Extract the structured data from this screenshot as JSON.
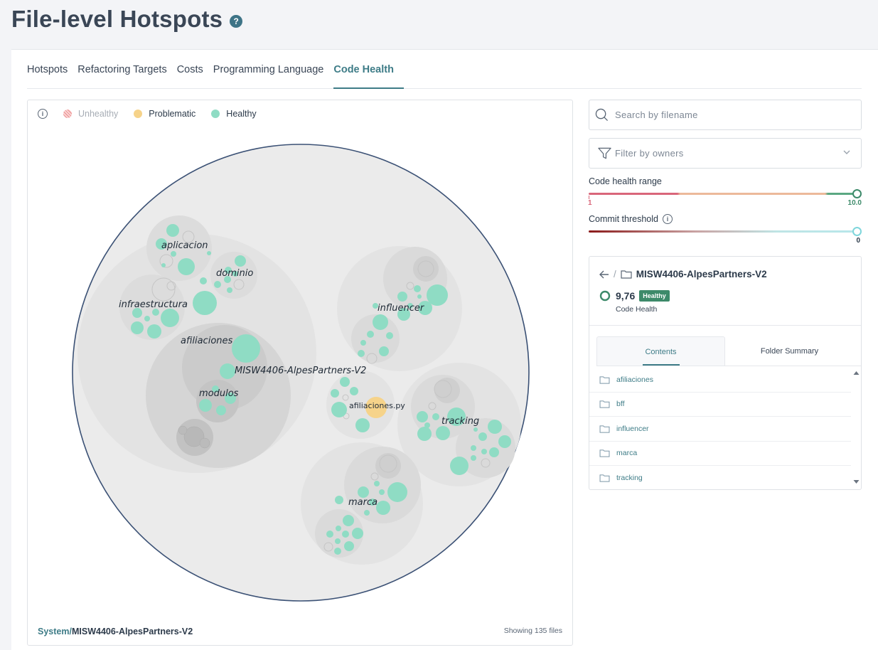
{
  "page": {
    "title": "File-level Hotspots",
    "help_glyph": "?"
  },
  "tabs": [
    {
      "label": "Hotspots",
      "active": false
    },
    {
      "label": "Refactoring Targets",
      "active": false
    },
    {
      "label": "Costs",
      "active": false
    },
    {
      "label": "Programming Language",
      "active": false
    },
    {
      "label": "Code Health",
      "active": true
    }
  ],
  "legend": [
    {
      "label": "Unhealthy",
      "color": "#f0b4b4",
      "dimmed": true
    },
    {
      "label": "Problematic",
      "color": "#f6d38a",
      "dimmed": false
    },
    {
      "label": "Healthy",
      "color": "#8fdcc4",
      "dimmed": false
    }
  ],
  "viz": {
    "labels": {
      "aplicacion": "aplicacion",
      "dominio": "dominio",
      "infraestructura": "infraestructura",
      "afiliaciones": "afiliaciones",
      "root": "MISW4406-AlpesPartners-V2",
      "modulos": "modulos",
      "influencer": "influencer",
      "afiliaciones_py": "afiliaciones.py",
      "tracking": "tracking",
      "marca": "marca"
    },
    "footer_system": "System",
    "footer_sep": "/",
    "footer_path": "MISW4406-AlpesPartners-V2",
    "count_text": "Showing 135 files"
  },
  "search": {
    "placeholder": "Search by filename"
  },
  "owners": {
    "placeholder": "Filter by owners"
  },
  "code_health_range": {
    "label": "Code health range",
    "min_label": "1",
    "max_label": "10.0",
    "min": 1,
    "max": 10.0
  },
  "commit_threshold": {
    "label": "Commit threshold",
    "value_label": "0",
    "value": 0
  },
  "folder_card": {
    "path": "MISW4406-AlpesPartners-V2",
    "score": "9,76",
    "badge": "Healthy",
    "score_label": "Code Health",
    "tabs": [
      {
        "label": "Contents",
        "active": true
      },
      {
        "label": "Folder Summary",
        "active": false
      }
    ],
    "items": [
      "afiliaciones",
      "bff",
      "influencer",
      "marca",
      "tracking"
    ]
  },
  "colors": {
    "accent": "#3e7c87",
    "healthy": "#8fdcc4",
    "problematic": "#f6d38a",
    "boundary": "#3b5175"
  }
}
